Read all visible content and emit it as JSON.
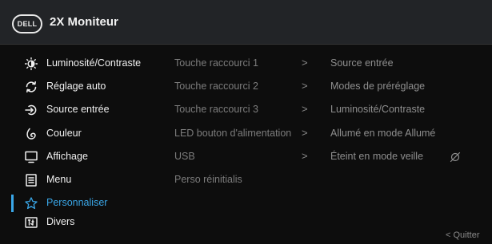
{
  "header": {
    "logo_text": "DELL",
    "title": "2X Moniteur"
  },
  "menu": {
    "items": [
      {
        "label": "Luminosité/Contraste",
        "icon": "brightness-icon"
      },
      {
        "label": "Réglage auto",
        "icon": "auto-adjust-icon"
      },
      {
        "label": "Source entrée",
        "icon": "input-source-icon"
      },
      {
        "label": "Couleur",
        "icon": "color-icon"
      },
      {
        "label": "Affichage",
        "icon": "display-icon"
      },
      {
        "label": "Menu",
        "icon": "menu-icon"
      },
      {
        "label": "Personnaliser",
        "icon": "star-icon",
        "active": true
      },
      {
        "label": "Divers",
        "icon": "others-icon"
      }
    ]
  },
  "submenu": {
    "items": [
      {
        "label": "Touche raccourci 1",
        "arrow": ">",
        "value": "Source entrée"
      },
      {
        "label": "Touche raccourci 2",
        "arrow": ">",
        "value": "Modes de préréglage"
      },
      {
        "label": "Touche raccourci 3",
        "arrow": ">",
        "value": "Luminosité/Contraste"
      },
      {
        "label": "LED bouton d'alimentation",
        "arrow": ">",
        "value": "Allumé en mode Allumé"
      },
      {
        "label": "USB",
        "arrow": ">",
        "value": "Éteint en mode veille"
      },
      {
        "label": "Perso réinitialis"
      }
    ]
  },
  "footer": {
    "quit_label": "< Quitter"
  },
  "colors": {
    "accent": "#3aa7e8",
    "header_bg": "#222427",
    "background": "#0d0d0d"
  }
}
